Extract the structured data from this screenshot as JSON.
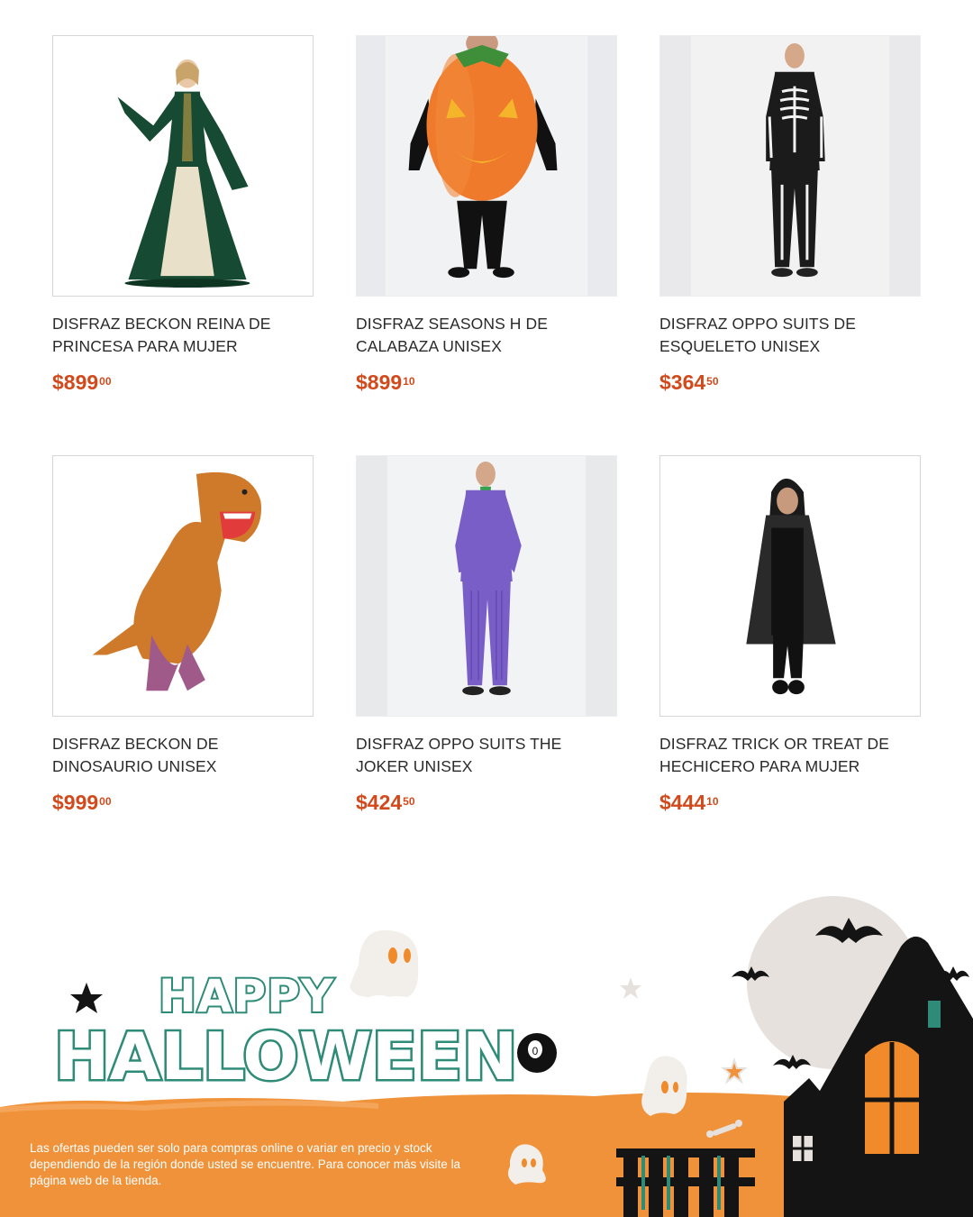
{
  "products": [
    {
      "title": "DISFRAZ BECKON REINA DE PRINCESA PARA MUJER",
      "price_int": "$899",
      "price_cents": "00",
      "image": "green-princess-dress"
    },
    {
      "title": "DISFRAZ SEASONS H DE CALABAZA UNISEX",
      "price_int": "$899",
      "price_cents": "10",
      "image": "pumpkin-costume"
    },
    {
      "title": "DISFRAZ OPPO SUITS DE ESQUELETO UNISEX",
      "price_int": "$364",
      "price_cents": "50",
      "image": "skeleton-suit"
    },
    {
      "title": "DISFRAZ BECKON DE DINOSAURIO UNISEX",
      "price_int": "$999",
      "price_cents": "00",
      "image": "inflatable-dinosaur"
    },
    {
      "title": "DISFRAZ OPPO SUITS THE JOKER UNISEX",
      "price_int": "$424",
      "price_cents": "50",
      "image": "purple-joker-suit"
    },
    {
      "title": "DISFRAZ TRICK OR TREAT DE HECHICERO PARA MUJER",
      "price_int": "$444",
      "price_cents": "10",
      "image": "black-witch-cape"
    }
  ],
  "banner": {
    "line1": "HAPPY",
    "line2": "HALLOWEEN",
    "disclaimer": "Las ofertas pueden ser solo para compras online o variar en precio y stock dependiendo de la región donde usted se encuentre. Para conocer más visite la página web de la tienda."
  },
  "colors": {
    "price": "#d24a1c",
    "banner_orange": "#f0923a",
    "banner_teal": "#2e8b78",
    "moon": "#e6e1dc"
  }
}
